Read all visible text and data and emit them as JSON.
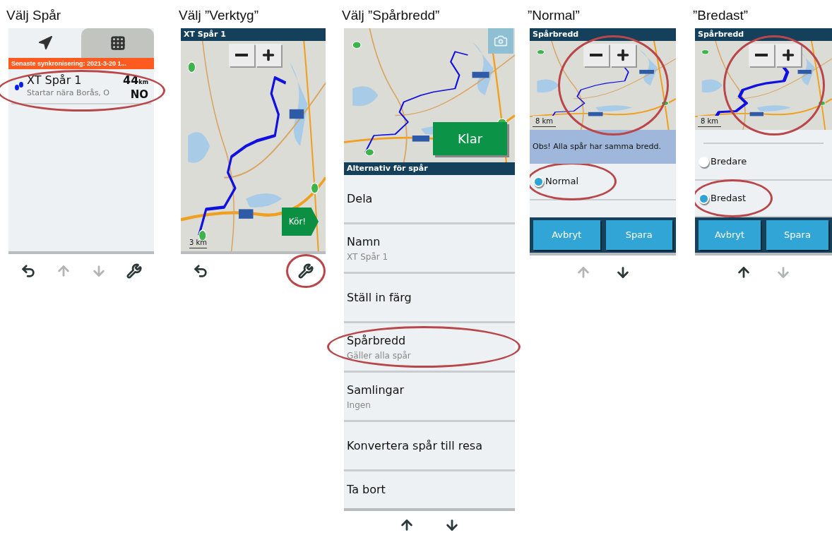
{
  "steps": [
    {
      "kind": "track_list",
      "caption": "Välj Spår",
      "tabs": [
        {
          "selected": true
        },
        {
          "selected": false
        }
      ],
      "sync_banner": "Senaste synkronisering: 2021-3-20 1...",
      "tracks": [
        {
          "name": "XT Spår 1",
          "subtitle": "Startar nära Borås, O",
          "distance": "44",
          "unit": "km",
          "direction": "NO",
          "highlighted": true
        }
      ],
      "nav": [
        {
          "kind": "back",
          "disabled": false,
          "highlighted": false
        },
        {
          "kind": "up",
          "disabled": true,
          "highlighted": false
        },
        {
          "kind": "down",
          "disabled": true,
          "highlighted": false
        },
        {
          "kind": "tools",
          "disabled": false,
          "highlighted": false
        }
      ]
    },
    {
      "kind": "map_view",
      "caption": "Välj ”Verktyg”",
      "title": "XT Spår 1",
      "scale": "3 km",
      "go_button": "Kör!",
      "nav": [
        {
          "kind": "back",
          "disabled": false,
          "highlighted": false
        },
        {
          "kind": "tools",
          "disabled": false,
          "highlighted": true
        }
      ]
    },
    {
      "kind": "options",
      "caption": "Välj ”Spårbredd”",
      "done_button": "Klar",
      "header": "Alternativ för spår",
      "options": [
        {
          "label": "Dela",
          "highlighted": false
        },
        {
          "label": "Namn",
          "sublabel": "XT Spår 1",
          "highlighted": false
        },
        {
          "label": "Ställ in färg",
          "highlighted": false
        },
        {
          "label": "Spårbredd",
          "sublabel": "Gäller alla spår",
          "highlighted": true
        },
        {
          "label": "Samlingar",
          "sublabel": "Ingen",
          "highlighted": false
        },
        {
          "label": "Konvertera spår till resa",
          "highlighted": false
        },
        {
          "label": "Ta bort",
          "highlighted": false
        }
      ],
      "nav": [
        {
          "kind": "up",
          "disabled": false,
          "highlighted": false
        },
        {
          "kind": "down",
          "disabled": false,
          "highlighted": false
        }
      ]
    },
    {
      "kind": "width_picker",
      "caption": "”Normal”",
      "title": "Spårbredd",
      "scale": "8 km",
      "map_highlighted": true,
      "notice": "Obs! Alla spår har samma bredd.",
      "options": [
        {
          "label": "Normal",
          "selected": true,
          "highlighted": true
        }
      ],
      "buttons": [
        "Avbryt",
        "Spara"
      ],
      "nav": [
        {
          "kind": "up",
          "disabled": true,
          "highlighted": false
        },
        {
          "kind": "down",
          "disabled": false,
          "highlighted": false
        }
      ]
    },
    {
      "kind": "width_picker",
      "caption": "”Bredast”",
      "title": "Spårbredd",
      "scale": "8 km",
      "map_highlighted": true,
      "options": [
        {
          "label": "Bredare",
          "selected": false,
          "highlighted": false
        },
        {
          "label": "Bredast",
          "selected": true,
          "highlighted": true
        }
      ],
      "buttons": [
        "Avbryt",
        "Spara"
      ],
      "nav": [
        {
          "kind": "up",
          "disabled": false,
          "highlighted": false
        },
        {
          "kind": "down",
          "disabled": true,
          "highlighted": false
        }
      ]
    }
  ]
}
